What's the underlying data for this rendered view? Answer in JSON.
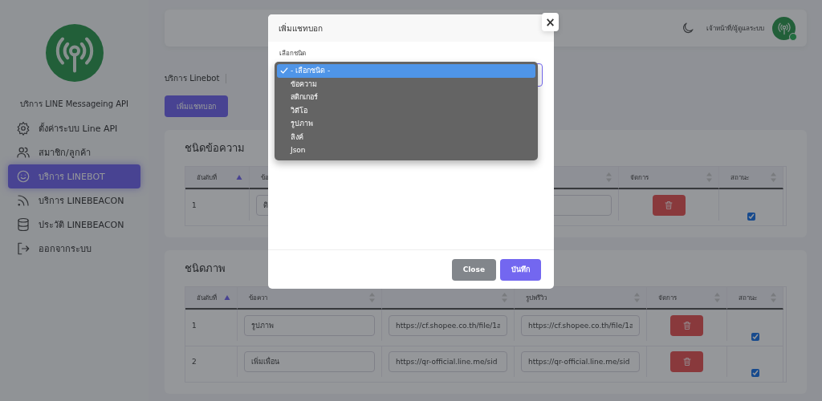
{
  "sidebar": {
    "title": "บริการ LINE Messageing API",
    "items": [
      {
        "label": "ตั้งค่าระบบ Line API",
        "selected": false
      },
      {
        "label": "สมาชิก/ลูกค้า",
        "selected": false
      },
      {
        "label": "บริการ LINEBOT",
        "selected": true
      },
      {
        "label": "บริการ LINEBEACON",
        "selected": false
      },
      {
        "label": "ประวัติ LINEBEACON",
        "selected": false
      },
      {
        "label": "ออกจากระบบ",
        "selected": false
      }
    ]
  },
  "topbar": {
    "user": "เจ้าหน้าที่/ผู้ดูแลระบบ",
    "online": true
  },
  "breadcrumb": "บริการ Linebot",
  "add_button": "เพิ่มแชทบอก",
  "tables": [
    {
      "title": "ชนิดข้อความ",
      "columns": [
        {
          "label": "อันดับที่",
          "sorted": true
        },
        {
          "label": "ข้อ",
          "sorted": false
        },
        {
          "sorted": false
        },
        {
          "label": "จัดการ",
          "sorted": false
        },
        {
          "label": "สถานะ",
          "sorted": false
        }
      ],
      "rows": [
        {
          "cells": [
            {
              "kind": "text",
              "text": "1"
            },
            {
              "kind": "field",
              "value": "ดิ"
            },
            {
              "kind": "field"
            },
            {
              "kind": "delete"
            },
            {
              "kind": "check",
              "checked": true
            }
          ]
        }
      ]
    },
    {
      "title": "ชนิดภาพ",
      "columns": [
        {
          "label": "อันดับที่",
          "sorted": true
        },
        {
          "label": "ข้อควา",
          "sorted": false
        },
        {
          "sorted": false
        },
        {
          "label": "รูปพรีวิว",
          "sorted": false
        },
        {
          "label": "จัดการ",
          "sorted": false
        },
        {
          "label": "สถานะ",
          "sorted": false
        }
      ],
      "rows": [
        {
          "cells": [
            {
              "kind": "text",
              "text": "1"
            },
            {
              "kind": "field",
              "value": "รูปภาพ"
            },
            {
              "kind": "field",
              "value": "https://cf.shopee.co.th/file/1a"
            },
            {
              "kind": "field",
              "value": "https://cf.shopee.co.th/file/1a"
            },
            {
              "kind": "delete"
            },
            {
              "kind": "check",
              "checked": true
            }
          ]
        },
        {
          "cells": [
            {
              "kind": "text",
              "text": "2"
            },
            {
              "kind": "field",
              "value": "เพิ่มเพื่อน"
            },
            {
              "kind": "field",
              "value": "https://qr-official.line.me/sid"
            },
            {
              "kind": "field",
              "value": "https://qr-official.line.me/sid"
            },
            {
              "kind": "delete"
            },
            {
              "kind": "check",
              "checked": true
            }
          ]
        }
      ]
    }
  ],
  "modal": {
    "title": "เพิ่มแชทบอก",
    "close": "×",
    "field_label": "เลือกชนิด",
    "options": [
      {
        "label": "- เลือกชนิด -",
        "selected": true
      },
      {
        "label": "ข้อความ",
        "selected": false
      },
      {
        "label": "สติกเกอร์",
        "selected": false
      },
      {
        "label": "วิดีโอ",
        "selected": false
      },
      {
        "label": "รูปภาพ",
        "selected": false
      },
      {
        "label": "ลิงค์",
        "selected": false
      },
      {
        "label": "Json",
        "selected": false
      }
    ],
    "buttons": [
      {
        "label": "Close",
        "kind": "secondary"
      },
      {
        "label": "บันทึก",
        "kind": "primary"
      }
    ]
  }
}
